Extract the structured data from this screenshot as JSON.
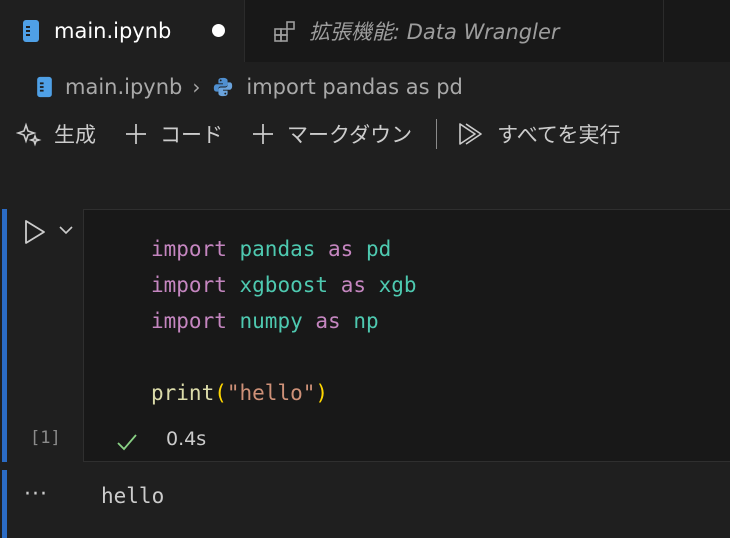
{
  "tabs": [
    {
      "label": "main.ipynb",
      "icon": "notebook-icon",
      "active": true,
      "dirty": true
    },
    {
      "label": "拡張機能: Data Wrangler",
      "icon": "extensions-icon",
      "active": false
    }
  ],
  "breadcrumb": {
    "file": "main.ipynb",
    "symbol": "import pandas as pd"
  },
  "toolbar": {
    "generate": "生成",
    "add_code": "コード",
    "add_markdown": "マークダウン",
    "run_all": "すべてを実行"
  },
  "cell": {
    "code_lines": [
      {
        "kw": "import",
        "mod": "pandas",
        "as": "as",
        "alias": "pd"
      },
      {
        "kw": "import",
        "mod": "xgboost",
        "as": "as",
        "alias": "xgb"
      },
      {
        "kw": "import",
        "mod": "numpy",
        "as": "as",
        "alias": "np"
      }
    ],
    "print_line": {
      "fn": "print",
      "open": "(",
      "arg": "\"hello\"",
      "close": ")"
    },
    "exec_count": "[1]",
    "exec_time": "0.4s",
    "output_dots": "···",
    "output_text": "hello"
  },
  "colors": {
    "accent_bar": "#2b6bc4",
    "keyword": "#c586c0",
    "module": "#4ec9b0",
    "function": "#dcdcaa",
    "string": "#ce9178",
    "success": "#89d185"
  }
}
